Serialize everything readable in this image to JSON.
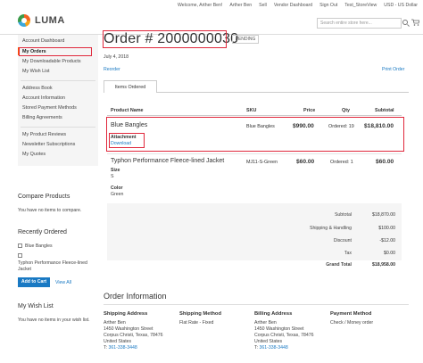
{
  "topbar": {
    "welcome": "Welcome, Arther Ben!",
    "account_menu": "Arther Ben",
    "sell": "Sell",
    "vendor_dashboard": "Vendor Dashboard",
    "sign_out": "Sign Out",
    "store_view": "Test_StoreView",
    "currency": "USD - US Dollar"
  },
  "brand": {
    "name": "LUMA"
  },
  "search": {
    "placeholder": "Search entire store here..."
  },
  "sidebar": {
    "items": [
      "Account Dashboard",
      "My Orders",
      "My Downloadable Products",
      "My Wish List",
      "Address Book",
      "Account Information",
      "Stored Payment Methods",
      "Billing Agreements",
      "My Product Reviews",
      "Newsletter Subscriptions",
      "My Quotes"
    ],
    "active_index": 1
  },
  "compare": {
    "title": "Compare Products",
    "empty": "You have no items to compare."
  },
  "recently_ordered": {
    "title": "Recently Ordered",
    "items": [
      "Blue Bangles",
      "Typhon Performance Fleece-lined Jacket"
    ],
    "add_to_cart": "Add to Cart",
    "view_all": "View All"
  },
  "wishlist": {
    "title": "My Wish List",
    "empty": "You have no items in your wish list."
  },
  "order": {
    "title": "Order # 2000000030",
    "status": "PENDING",
    "date": "July 4, 2018",
    "reorder": "Reorder",
    "print": "Print Order",
    "tab": "Items Ordered",
    "columns": [
      "Product Name",
      "SKU",
      "Price",
      "Qty",
      "Subtotal"
    ],
    "items": [
      {
        "name": "Blue Bangles",
        "attachment_label": "Attachment",
        "attachment_link": "Download",
        "sku": "Blue Bangles",
        "price": "$990.00",
        "qty": "Ordered: 19",
        "subtotal": "$18,810.00"
      },
      {
        "name": "Typhon Performance Fleece-lined Jacket",
        "size_label": "Size",
        "size_value": "S",
        "color_label": "Color",
        "color_value": "Green",
        "sku": "MJ11-S-Green",
        "price": "$60.00",
        "qty": "Ordered: 1",
        "subtotal": "$60.00"
      }
    ],
    "totals": [
      {
        "label": "Subtotal",
        "value": "$18,870.00"
      },
      {
        "label": "Shipping & Handling",
        "value": "$100.00"
      },
      {
        "label": "Discount",
        "value": "-$12.00"
      },
      {
        "label": "Tax",
        "value": "$0.00"
      },
      {
        "label": "Grand Total",
        "value": "$18,958.00"
      }
    ]
  },
  "order_info": {
    "title": "Order Information",
    "shipping_address": {
      "title": "Shipping Address",
      "lines": [
        "Arther Ben",
        "1450 Washington Street",
        "Corpus Christi, Texas, 78476",
        "United States"
      ],
      "phone_prefix": "T:",
      "phone": "361-338-3448"
    },
    "shipping_method": {
      "title": "Shipping Method",
      "value": "Flat Rate - Fixed"
    },
    "billing_address": {
      "title": "Billing Address",
      "lines": [
        "Arther Ben",
        "1450 Washington Street",
        "Corpus Christi, Texas, 78476",
        "United States"
      ],
      "phone_prefix": "T:",
      "phone": "361-338-3448"
    },
    "payment_method": {
      "title": "Payment Method",
      "value": "Check / Money order"
    }
  },
  "colors": {
    "accent": "#1979c3",
    "highlight": "#e0283c",
    "active": "#ff5501"
  }
}
